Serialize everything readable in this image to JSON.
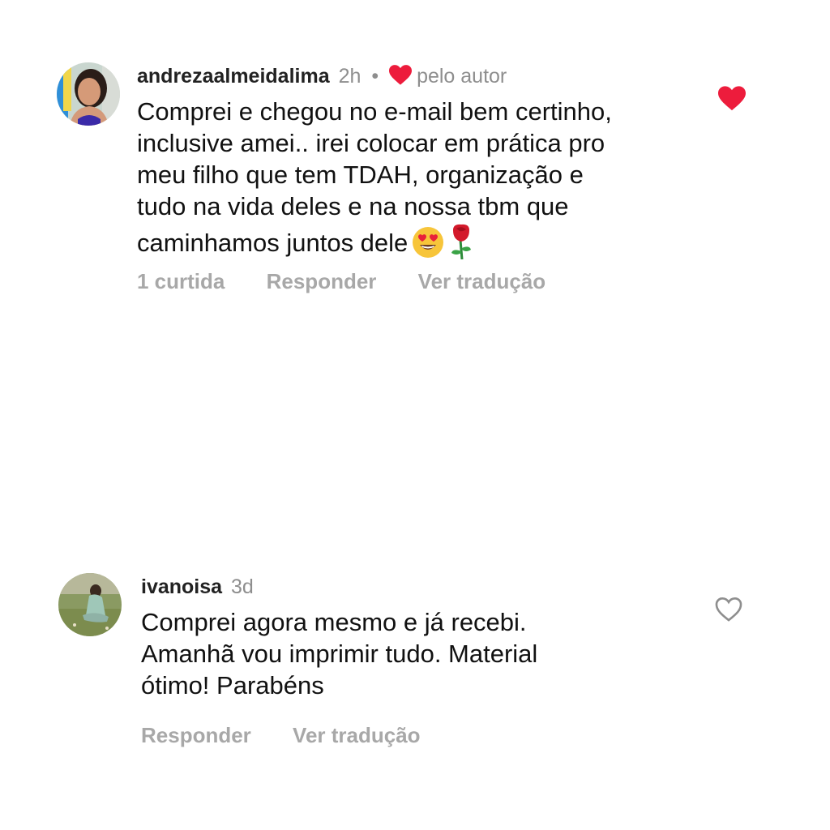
{
  "comments": [
    {
      "username": "andrezaalmeidalima",
      "time": "2h",
      "separator": "•",
      "author_badge": "pelo autor",
      "text_lines": [
        "Comprei e chegou no e-mail bem certinho,",
        "inclusive amei.. irei colocar em prática pro",
        "meu filho que tem TDAH, organização e",
        "tudo na vida deles e na nossa tbm que",
        "caminhamos juntos dele"
      ],
      "emojis": [
        "heart-eyes-emoji",
        "rose-emoji"
      ],
      "likes_label": "1 curtida",
      "reply_label": "Responder",
      "translate_label": "Ver tradução",
      "liked": true,
      "like_icon": "heart-filled-icon",
      "like_color": "#ed1c3c"
    },
    {
      "username": "ivanoisa",
      "time": "3d",
      "text_lines": [
        "Comprei agora mesmo e já recebi.",
        "Amanhã vou imprimir tudo. Material",
        "ótimo! Parabéns"
      ],
      "reply_label": "Responder",
      "translate_label": "Ver tradução",
      "liked": false,
      "like_icon": "heart-outline-icon"
    }
  ],
  "colors": {
    "muted": "#8e8e8e",
    "action": "#a8a8a8",
    "heart_red": "#ed1c3c",
    "text": "#111111"
  }
}
